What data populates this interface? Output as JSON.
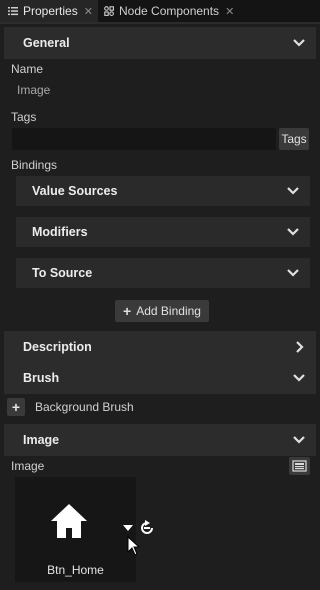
{
  "tabs": [
    {
      "label": "Properties",
      "icon": "list-icon",
      "active": true
    },
    {
      "label": "Node Components",
      "icon": "node-components-icon",
      "active": false
    }
  ],
  "sections": {
    "general": {
      "title": "General"
    },
    "description": {
      "title": "Description"
    },
    "brush": {
      "title": "Brush"
    },
    "image": {
      "title": "Image"
    }
  },
  "general": {
    "name_label": "Name",
    "name_value": "Image",
    "tags_label": "Tags",
    "tags_value": "",
    "tags_button": "Tags",
    "bindings_label": "Bindings",
    "bindings": [
      {
        "title": "Value Sources"
      },
      {
        "title": "Modifiers"
      },
      {
        "title": "To Source"
      }
    ],
    "add_binding_label": "Add Binding"
  },
  "brush": {
    "add_label": "+",
    "background_brush_label": "Background Brush"
  },
  "image": {
    "image_label": "Image",
    "thumbnail_name": "Btn_Home",
    "thumbnail_icon": "home-icon"
  },
  "colors": {
    "background": "#1e1e1e",
    "section": "#2c2c2c",
    "button": "#3a3a3a",
    "input": "#151515"
  }
}
